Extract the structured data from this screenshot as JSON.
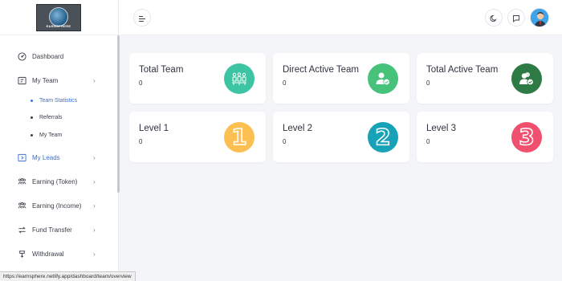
{
  "logo": {
    "text": "EARNSPHERE",
    "icon": "globe-logo"
  },
  "sidebar": {
    "items": [
      {
        "label": "Dashboard",
        "icon": "speedometer-icon"
      },
      {
        "label": "My Team",
        "icon": "team-box-icon",
        "chevron": "›"
      },
      {
        "label": "My Leads",
        "icon": "leads-icon",
        "chevron": "›"
      },
      {
        "label": "Earning (Token)",
        "icon": "people-icon",
        "chevron": "›"
      },
      {
        "label": "Earning (Income)",
        "icon": "people-icon",
        "chevron": "›"
      },
      {
        "label": "Fund Transfer",
        "icon": "transfer-icon",
        "chevron": "›"
      },
      {
        "label": "Withdrawal",
        "icon": "withdraw-icon",
        "chevron": "›"
      }
    ],
    "sub_items": [
      {
        "label": "Team Statistics",
        "active": true
      },
      {
        "label": "Referrals",
        "active": false
      },
      {
        "label": "My Team",
        "active": false
      }
    ]
  },
  "header": {
    "menu_icon": "menu-toggle-icon",
    "theme_icon": "moon-icon",
    "chat_icon": "chat-icon",
    "avatar": "user-avatar"
  },
  "cards": [
    {
      "title": "Total Team",
      "value": "0",
      "color": "#3cc4a3",
      "icon": "team-group-icon"
    },
    {
      "title": "Direct Active Team",
      "value": "0",
      "color": "#47c27a",
      "icon": "user-check-icon"
    },
    {
      "title": "Total Active Team",
      "value": "0",
      "color": "#2e7a44",
      "icon": "users-check-icon"
    },
    {
      "title": "Level 1",
      "value": "0",
      "color": "#fbbf52",
      "glyph": "1"
    },
    {
      "title": "Level 2",
      "value": "0",
      "color": "#17a2b8",
      "glyph": "2"
    },
    {
      "title": "Level 3",
      "value": "0",
      "color": "#f0506e",
      "glyph": "3"
    }
  ],
  "statusbar": {
    "url": "https://earnsphere.netlify.app/dashboard/team/overview"
  },
  "colors": {
    "accent": "#3a6fd8",
    "background": "#f4f5f8"
  }
}
